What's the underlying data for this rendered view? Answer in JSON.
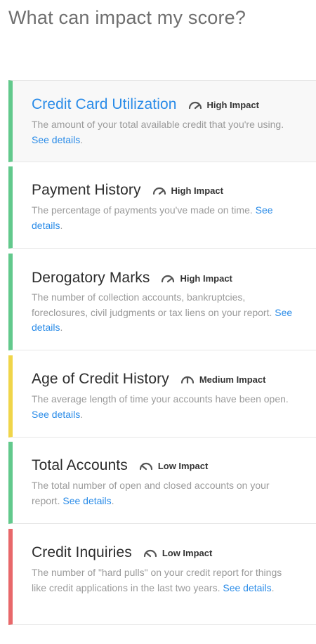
{
  "title": "What can impact my score?",
  "see_details_label": "See details",
  "period": ".",
  "colors": {
    "high": "#62c98c",
    "medium": "#f0d54a",
    "low": "#e8686a",
    "link": "#2b8ce8"
  },
  "factors": [
    {
      "title": "Credit Card Utilization",
      "impact": "High Impact",
      "gauge_icon": "gauge-high-icon",
      "description": "The amount of your total available credit that you're using.",
      "indicator_color": "#62c98c"
    },
    {
      "title": "Payment History",
      "impact": "High Impact",
      "gauge_icon": "gauge-high-icon",
      "description": "The percentage of payments you've made on time.",
      "indicator_color": "#62c98c"
    },
    {
      "title": "Derogatory Marks",
      "impact": "High Impact",
      "gauge_icon": "gauge-high-icon",
      "description": "The number of collection accounts, bankruptcies, foreclosures, civil judgments or tax liens on your report.",
      "indicator_color": "#62c98c"
    },
    {
      "title": "Age of Credit History",
      "impact": "Medium Impact",
      "gauge_icon": "gauge-medium-icon",
      "description": "The average length of time your accounts have been open.",
      "indicator_color": "#f0d54a"
    },
    {
      "title": "Total Accounts",
      "impact": "Low Impact",
      "gauge_icon": "gauge-low-icon",
      "description": "The total number of open and closed accounts on your report.",
      "indicator_color": "#62c98c"
    },
    {
      "title": "Credit Inquiries",
      "impact": "Low Impact",
      "gauge_icon": "gauge-low-icon",
      "description": "The number of \"hard pulls\" on your credit report for things like credit applications in the last two years.",
      "indicator_color": "#e8686a"
    }
  ]
}
